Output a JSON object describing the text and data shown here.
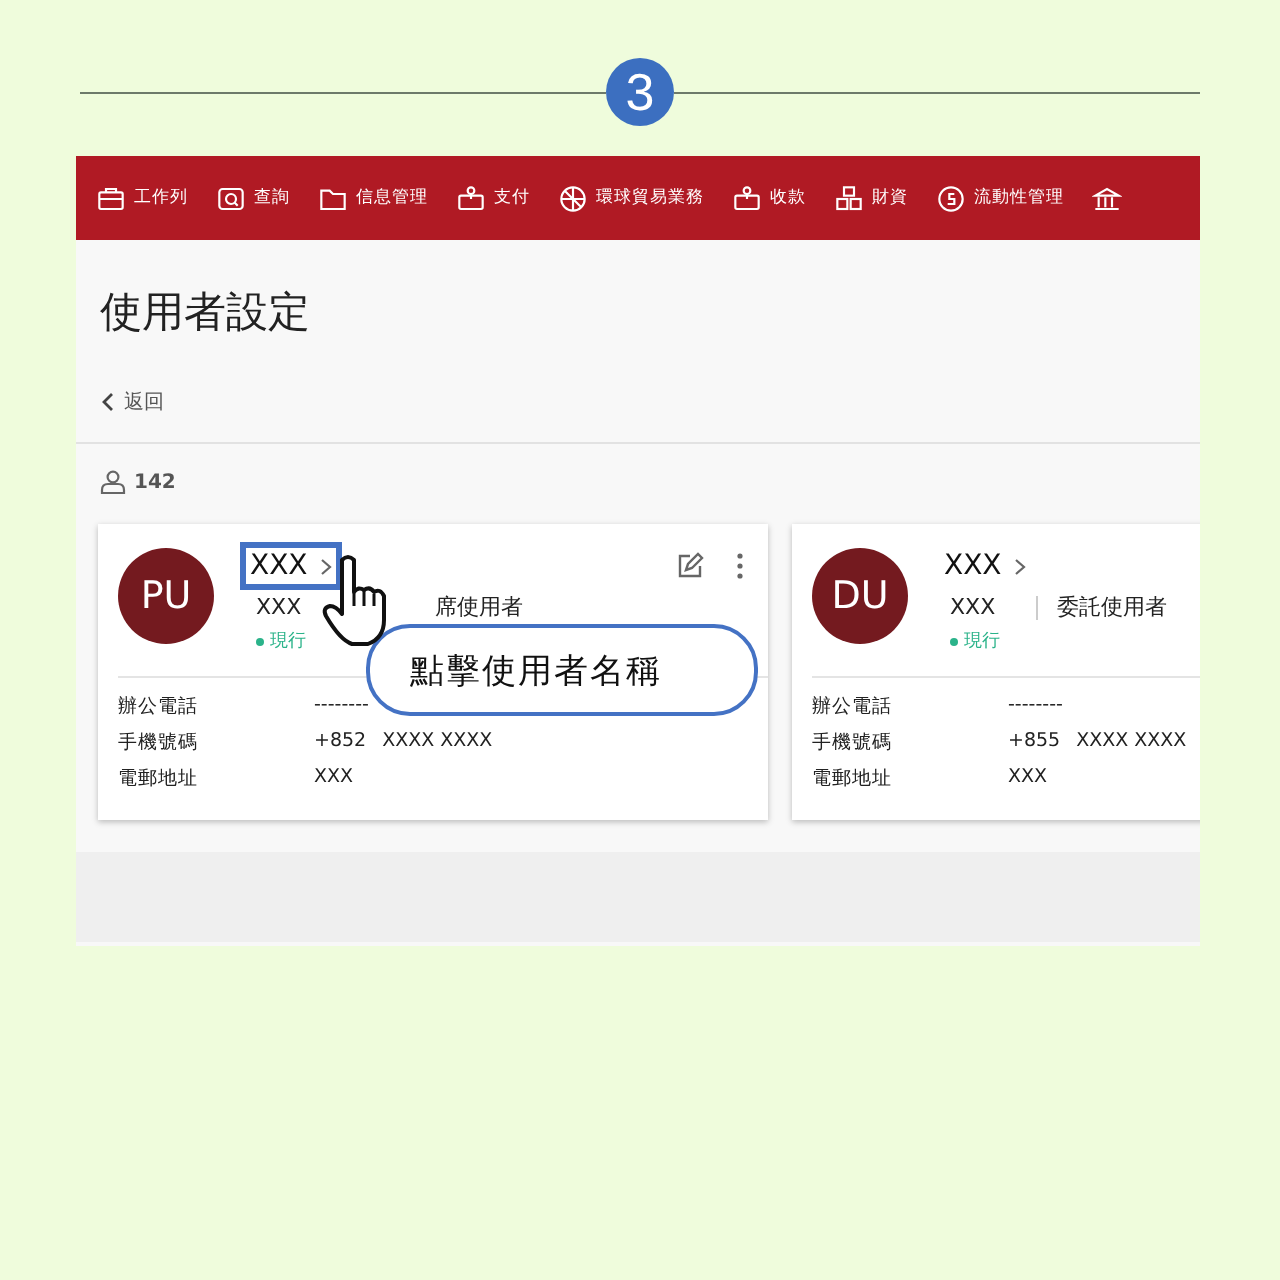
{
  "step": {
    "number": "3"
  },
  "nav": [
    {
      "kind": "briefcase",
      "label": "工作列"
    },
    {
      "kind": "search",
      "label": "查詢"
    },
    {
      "kind": "folder",
      "label": "信息管理"
    },
    {
      "kind": "pay",
      "label": "支付"
    },
    {
      "kind": "globe",
      "label": "環球貿易業務"
    },
    {
      "kind": "pay",
      "label": "收款"
    },
    {
      "kind": "blocks",
      "label": "財資"
    },
    {
      "kind": "coin",
      "label": "流動性管理"
    },
    {
      "kind": "bank"
    }
  ],
  "page": {
    "title": "使用者設定",
    "back": "返回",
    "count": "142"
  },
  "users": [
    {
      "initials": "PU",
      "name": "XXX",
      "login": "XXX",
      "role": "席使用者",
      "status": "現行",
      "highlighted": true,
      "actions": true,
      "fields": [
        {
          "label": "辦公電話",
          "value": "--------"
        },
        {
          "label": "手機號碼",
          "code": "+852",
          "value": "XXXX XXXX"
        },
        {
          "label": "電郵地址",
          "value": "XXX"
        }
      ]
    },
    {
      "initials": "DU",
      "name": "XXX",
      "login": "XXX",
      "role": "委託使用者",
      "status": "現行",
      "highlighted": false,
      "actions": false,
      "fields": [
        {
          "label": "辦公電話",
          "value": "--------"
        },
        {
          "label": "手機號碼",
          "code": "+855",
          "value": "XXXX XXXX"
        },
        {
          "label": "電郵地址",
          "value": "XXX"
        }
      ]
    }
  ],
  "callout": "點擊使用者名稱"
}
